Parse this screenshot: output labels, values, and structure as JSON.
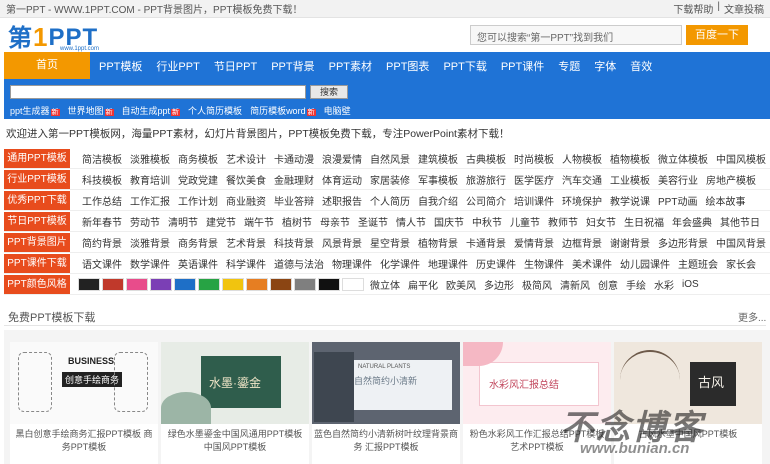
{
  "topbar": {
    "site_text": "第一PPT - WWW.1PPT.COM - PPT背景图片，PPT模板免费下载！",
    "help": "下载帮助",
    "sep": "|",
    "submit": "文章投稿"
  },
  "logo": {
    "cn": "第",
    "one": "1",
    "ppt": "PPT",
    "url": "www.1ppt.com"
  },
  "search": {
    "placeholder": "您可以搜索“第一PPT”找到我们",
    "button": "百度一下"
  },
  "nav": {
    "home": "首页",
    "items": [
      "PPT模板",
      "行业PPT",
      "节日PPT",
      "PPT背景",
      "PPT素材",
      "PPT图表",
      "PPT下载",
      "PPT课件",
      "专题",
      "字体",
      "音效"
    ]
  },
  "subsearch": {
    "button": "搜索",
    "links": [
      "ppt生成器",
      "世界地图",
      "自动生成ppt",
      "个人简历模板",
      "简历模板word",
      "电脑壁"
    ]
  },
  "welcome": "欢迎进入第一PPT模板网，海量PPT素材，幻灯片背景图片，PPT模板免费下载，专注PowerPoint素材下载！",
  "categories": [
    {
      "label": "通用PPT模板",
      "tags": [
        "简洁模板",
        "淡雅模板",
        "商务模板",
        "艺术设计",
        "卡通动漫",
        "浪漫爱情",
        "自然风景",
        "建筑模板",
        "古典模板",
        "时尚模板",
        "人物模板",
        "植物模板",
        "微立体模板",
        "中国风模板"
      ]
    },
    {
      "label": "行业PPT模板",
      "tags": [
        "科技模板",
        "教育培训",
        "党政党建",
        "餐饮美食",
        "金融理财",
        "体育运动",
        "家居装修",
        "军事模板",
        "旅游旅行",
        "医学医疗",
        "汽车交通",
        "工业模板",
        "美容行业",
        "房地产模板"
      ]
    },
    {
      "label": "优秀PPT下载",
      "tags": [
        "工作总结",
        "工作汇报",
        "工作计划",
        "商业融资",
        "毕业答辩",
        "述职报告",
        "个人简历",
        "自我介绍",
        "公司简介",
        "培训课件",
        "环境保护",
        "教学说课",
        "PPT动画",
        "绘本故事"
      ]
    },
    {
      "label": "节日PPT模板",
      "tags": [
        "新年春节",
        "劳动节",
        "清明节",
        "建党节",
        "端午节",
        "植树节",
        "母亲节",
        "圣诞节",
        "情人节",
        "国庆节",
        "中秋节",
        "儿童节",
        "教师节",
        "妇女节",
        "生日祝福",
        "年会盛典",
        "其他节日"
      ]
    },
    {
      "label": "PPT背景图片",
      "tags": [
        "简约背景",
        "淡雅背景",
        "商务背景",
        "艺术背景",
        "科技背景",
        "风景背景",
        "星空背景",
        "植物背景",
        "卡通背景",
        "爱情背景",
        "边框背景",
        "谢谢背景",
        "多边形背景",
        "中国风背景"
      ]
    },
    {
      "label": "PPT课件下载",
      "tags": [
        "语文课件",
        "数学课件",
        "英语课件",
        "科学课件",
        "道德与法治",
        "物理课件",
        "化学课件",
        "地理课件",
        "历史课件",
        "生物课件",
        "美术课件",
        "幼儿园课件",
        "主题班会",
        "家长会"
      ]
    },
    {
      "label": "PPT颜色风格",
      "tags": [
        "微立体",
        "扁平化",
        "欧美风",
        "多边形",
        "极简风",
        "清新风",
        "创意",
        "手绘",
        "水彩",
        "iOS"
      ]
    }
  ],
  "swatches": [
    "#222222",
    "#c0392b",
    "#e84c8b",
    "#7b3fb5",
    "#1e6fc7",
    "#27a344",
    "#f1c40f",
    "#e67e22",
    "#8b4513",
    "#7f7f7f",
    "#111111",
    "#ffffff"
  ],
  "section": {
    "title": "免费PPT模板下载",
    "more": "更多..."
  },
  "cards": [
    {
      "caption": "黑白创意手绘商务汇报PPT模板 商务PPT模板",
      "thumb_text_1": "BUSINESS",
      "thumb_text_2": "创意手绘商务"
    },
    {
      "caption": "绿色水墨鎏金中国风通用PPT模板 中国风PPT模板",
      "thumb_text_1": "水墨·鎏金",
      "thumb_text_2": ""
    },
    {
      "caption": "蓝色自然简约小清新树叶纹理背景商务 汇报PPT模板",
      "thumb_text_1": "NATURAL PLANTS",
      "thumb_text_2": "自然简约小清新"
    },
    {
      "caption": "粉色水彩风工作汇报总结PPT模板 艺术PPT模板",
      "thumb_text_1": "水彩风汇报总结",
      "thumb_text_2": ""
    },
    {
      "caption": "古风水墨中国风PPT模板",
      "thumb_text_1": "古风",
      "thumb_text_2": ""
    }
  ],
  "watermark": {
    "line1": "不念博客",
    "line2": "www.bunian.cn"
  }
}
